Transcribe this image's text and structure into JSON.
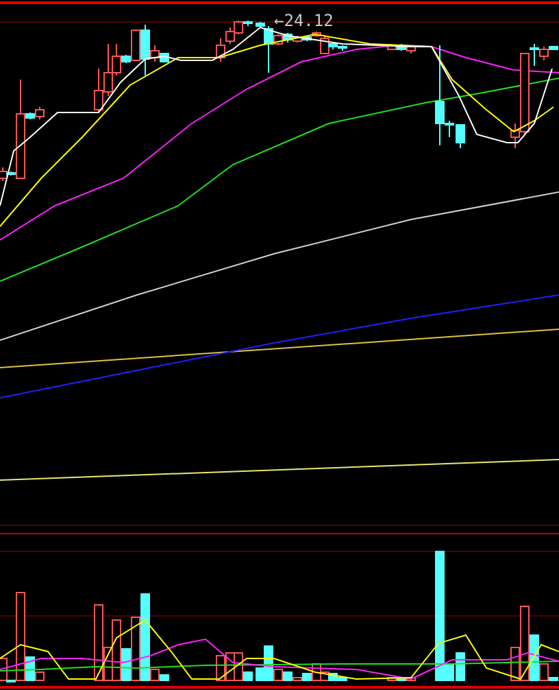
{
  "price_chart": {
    "high_label": "←24.12"
  }
}
